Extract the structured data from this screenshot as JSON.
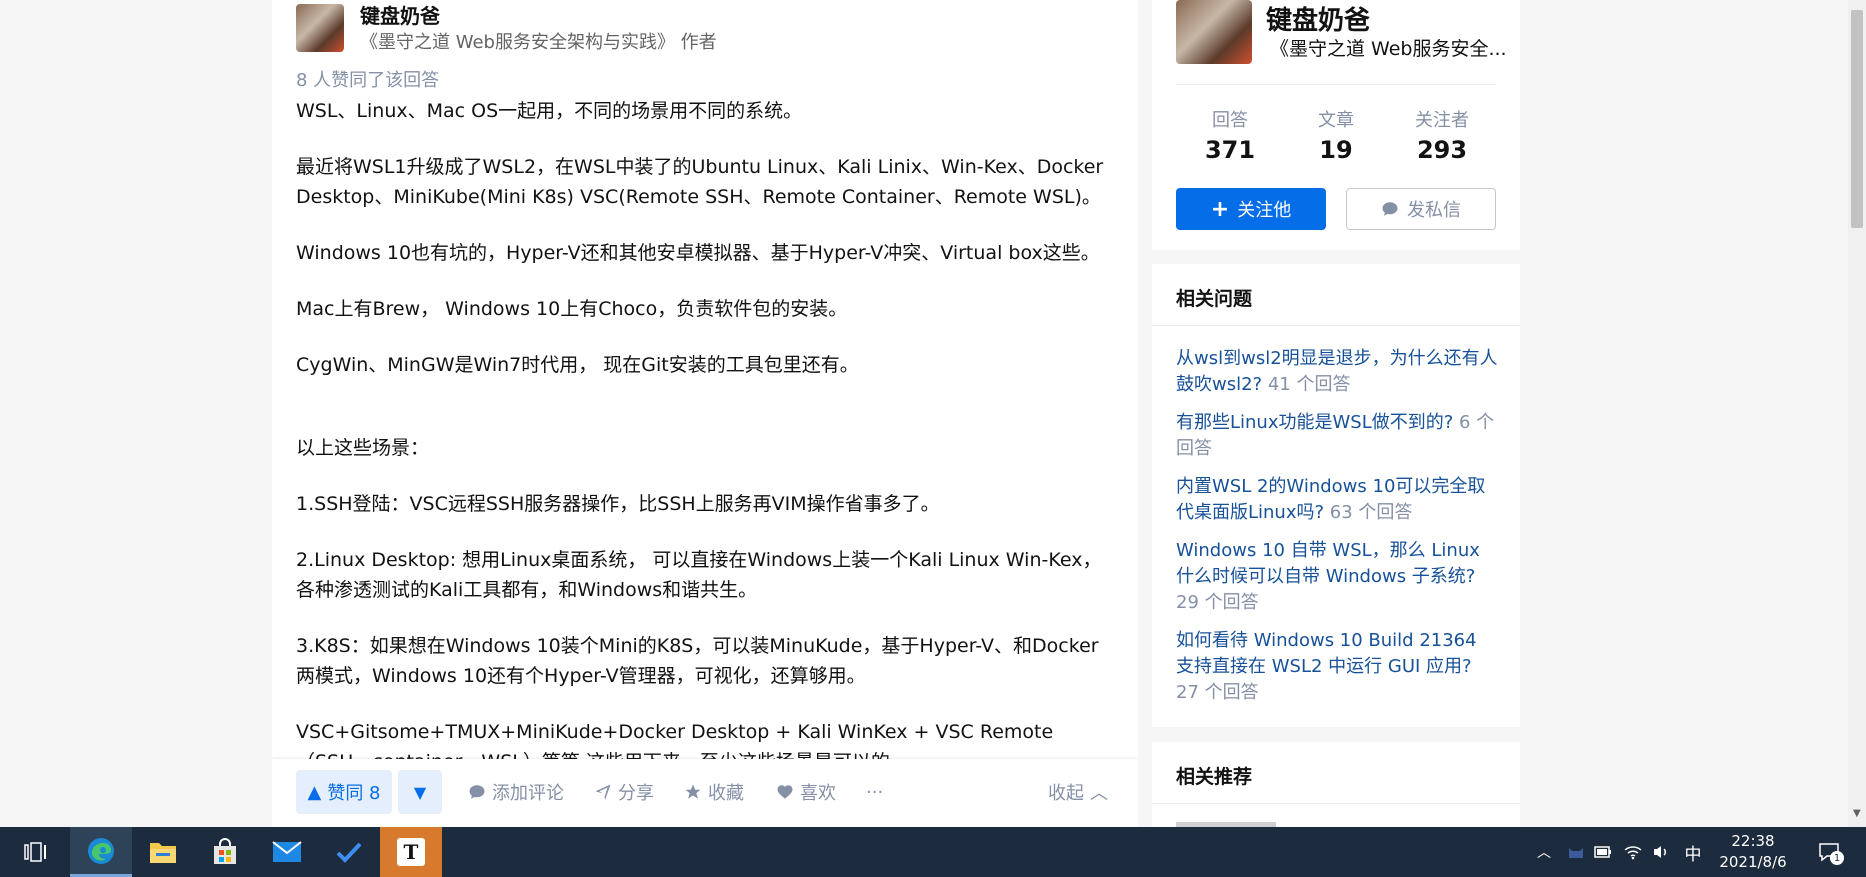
{
  "answer": {
    "author": {
      "name": "键盘奶爸",
      "bio": "《墨守之道 Web服务安全架构与实践》 作者"
    },
    "vote_summary": "8 人赞同了该回答",
    "paragraphs": [
      "WSL、Linux、Mac OS一起用，不同的场景用不同的系统。",
      "最近将WSL1升级成了WSL2，在WSL中装了的Ubuntu Linux、Kali Linix、Win-Kex、Docker Desktop、MiniKube(Mini K8s) VSC(Remote SSH、Remote Container、Remote WSL)。",
      "Windows 10也有坑的，Hyper-V还和其他安卓模拟器、基于Hyper-V冲突、Virtual box这些。",
      "Mac上有Brew， Windows 10上有Choco，负责软件包的安装。",
      "CygWin、MinGW是Win7时代用， 现在Git安装的工具包里还有。",
      "以上这些场景：",
      "1.SSH登陆：VSC远程SSH服务器操作，比SSH上服务再VIM操作省事多了。",
      "2.Linux Desktop: 想用Linux桌面系统， 可以直接在Windows上装一个Kali Linux Win-Kex，各种渗透测试的Kali工具都有，和Windows和谐共生。",
      "3.K8S：如果想在Windows 10装个Mini的K8S，可以装MinuKude，基于Hyper-V、和Docker两模式，Windows 10还有个Hyper-V管理器，可视化，还算够用。",
      "VSC+Gitsome+TMUX+MiniKude+Docker Desktop + Kali WinKex + VSC Remote（SSH、container、WSL）等等 这些用下来，至少这些场景是可以的。"
    ],
    "actions": {
      "vote_up": "赞同 8",
      "comment": "添加评论",
      "share": "分享",
      "collect": "收藏",
      "like": "喜欢",
      "more": "···",
      "collapse": "收起"
    }
  },
  "profile": {
    "name": "键盘奶爸",
    "bio": "《墨守之道 Web服务安全...",
    "stats": [
      {
        "label": "回答",
        "value": "371"
      },
      {
        "label": "文章",
        "value": "19"
      },
      {
        "label": "关注者",
        "value": "293"
      }
    ],
    "follow_label": "关注他",
    "message_label": "发私信"
  },
  "related_questions": {
    "title": "相关问题",
    "items": [
      {
        "text": "从wsl到wsl2明显是退步，为什么还有人鼓吹wsl2?",
        "count": "41 个回答"
      },
      {
        "text": "有那些Linux功能是WSL做不到的?",
        "count": "6 个回答"
      },
      {
        "text": "内置WSL 2的Windows 10可以完全取代桌面版Linux吗?",
        "count": "63 个回答"
      },
      {
        "text": "Windows 10 自带 WSL，那么 Linux 什么时候可以自带 Windows 子系统?",
        "count": "29 个回答"
      },
      {
        "text": "如何看待 Windows 10 Build 21364 支持直接在 WSL2 中运行 GUI 应用?",
        "count": "27 个回答"
      }
    ]
  },
  "recommend": {
    "title": "相关推荐"
  },
  "taskbar": {
    "time": "22:38",
    "date": "2021/8/6",
    "ime": "中",
    "notification_count": "1",
    "typora_letter": "T"
  },
  "colors": {
    "accent": "#056de8",
    "link": "#175199",
    "muted": "#8590a6",
    "taskbar": "#1c2b3d"
  }
}
